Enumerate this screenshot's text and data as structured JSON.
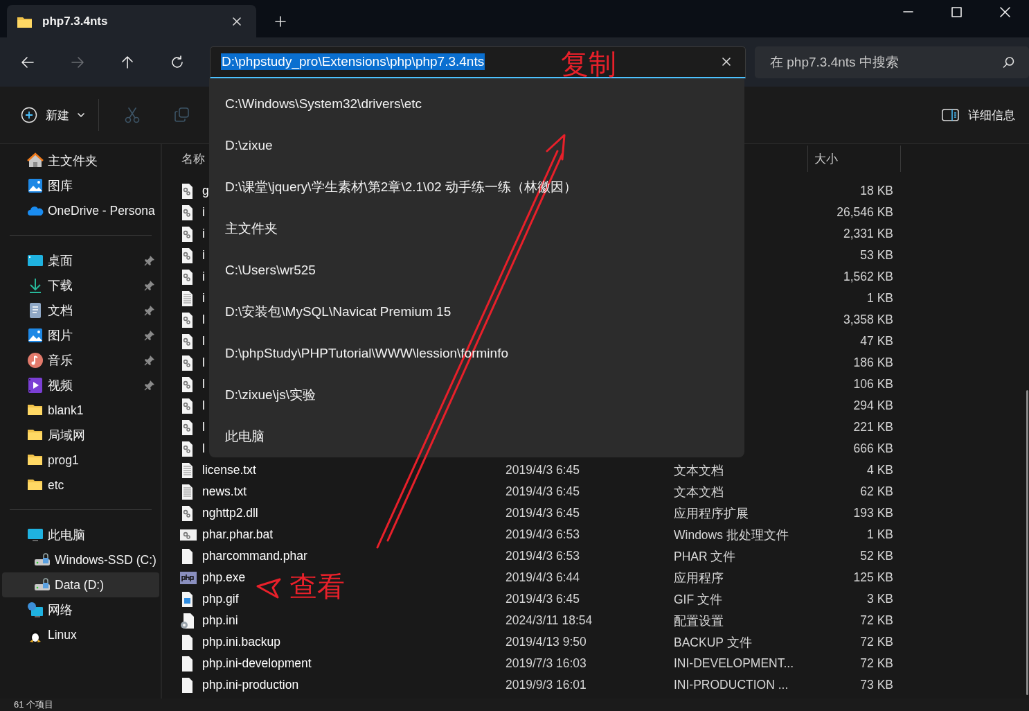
{
  "tabs": [
    {
      "title": "php7.3.4nts",
      "selected": true
    }
  ],
  "nav_buttons": [
    {
      "kind": "back",
      "disabled": false
    },
    {
      "kind": "forward",
      "disabled": true
    },
    {
      "kind": "up",
      "disabled": false
    },
    {
      "kind": "refresh",
      "disabled": false
    }
  ],
  "address_bar": {
    "value": "D:\\phpstudy_pro\\Extensions\\php\\php7.3.4nts",
    "selected": true
  },
  "address_history": [
    "C:\\Windows\\System32\\drivers\\etc",
    "D:\\zixue",
    "D:\\课堂\\jquery\\学生素材\\第2章\\2.1\\02 动手练一练（林徽因）",
    "主文件夹",
    "C:\\Users\\wr525",
    "D:\\安装包\\MySQL\\Navicat Premium 15",
    "D:\\phpStudy\\PHPTutorial\\WWW\\lession\\forminfo",
    "D:\\zixue\\js\\实验",
    "此电脑"
  ],
  "search": {
    "placeholder": "在 php7.3.4nts 中搜索"
  },
  "toolbar": {
    "new_button": {
      "label": "新建"
    },
    "actions": [
      {
        "kind": "cut",
        "disabled": true
      },
      {
        "kind": "copy",
        "disabled": true
      }
    ],
    "details_button": {
      "label": "详细信息"
    }
  },
  "sidebar": {
    "groups": [
      [
        {
          "label": "主文件夹",
          "kind": "home",
          "pinned": false,
          "selected": false
        },
        {
          "label": "图库",
          "kind": "gallery",
          "pinned": false,
          "selected": false
        },
        {
          "label": "OneDrive - Persona",
          "kind": "cloud",
          "pinned": false,
          "selected": false
        }
      ],
      [
        {
          "label": "桌面",
          "kind": "desktop",
          "pinned": true,
          "selected": false
        },
        {
          "label": "下载",
          "kind": "download",
          "pinned": true,
          "selected": false
        },
        {
          "label": "文档",
          "kind": "document",
          "pinned": true,
          "selected": false
        },
        {
          "label": "图片",
          "kind": "pictures",
          "pinned": true,
          "selected": false
        },
        {
          "label": "音乐",
          "kind": "music",
          "pinned": true,
          "selected": false
        },
        {
          "label": "视频",
          "kind": "video",
          "pinned": true,
          "selected": false
        },
        {
          "label": "blank1",
          "kind": "folder",
          "pinned": false,
          "selected": false
        },
        {
          "label": "局域网",
          "kind": "folder",
          "pinned": false,
          "selected": false
        },
        {
          "label": "prog1",
          "kind": "folder",
          "pinned": false,
          "selected": false
        },
        {
          "label": "etc",
          "kind": "folder",
          "pinned": false,
          "selected": false
        }
      ],
      [
        {
          "label": "此电脑",
          "kind": "pc",
          "pinned": false,
          "selected": false,
          "children": [
            {
              "label": "Windows-SSD (C:)",
              "kind": "drive",
              "pinned": false,
              "selected": false
            },
            {
              "label": "Data (D:)",
              "kind": "drive",
              "pinned": false,
              "selected": true
            }
          ]
        },
        {
          "label": "网络",
          "kind": "network",
          "pinned": false,
          "selected": false
        },
        {
          "label": "Linux",
          "kind": "linux",
          "pinned": false,
          "selected": false
        }
      ]
    ]
  },
  "file_list": {
    "columns": [
      "名称",
      "大小"
    ],
    "rows": [
      {
        "kind": "dll",
        "name": "g",
        "size": "18 KB"
      },
      {
        "kind": "dll",
        "name": "i",
        "size": "26,546 KB"
      },
      {
        "kind": "dll",
        "name": "i",
        "size": "2,331 KB"
      },
      {
        "kind": "dll",
        "name": "i",
        "size": "53 KB"
      },
      {
        "kind": "dll",
        "name": "i",
        "size": "1,562 KB"
      },
      {
        "kind": "txt",
        "name": "i",
        "size": "1 KB"
      },
      {
        "kind": "dll",
        "name": "l",
        "size": "3,358 KB"
      },
      {
        "kind": "dll",
        "name": "l",
        "size": "47 KB"
      },
      {
        "kind": "dll",
        "name": "l",
        "size": "186 KB"
      },
      {
        "kind": "dll",
        "name": "l",
        "size": "106 KB"
      },
      {
        "kind": "dll",
        "name": "l",
        "size": "294 KB"
      },
      {
        "kind": "dll",
        "name": "l",
        "size": "221 KB"
      },
      {
        "kind": "dll",
        "name": "l",
        "size": "666 KB"
      },
      {
        "kind": "txt",
        "name": "license.txt",
        "date": "2019/4/3 6:45",
        "type": "文本文档",
        "size": "4 KB"
      },
      {
        "kind": "txt",
        "name": "news.txt",
        "date": "2019/4/3 6:45",
        "type": "文本文档",
        "size": "62 KB"
      },
      {
        "kind": "dll",
        "name": "nghttp2.dll",
        "date": "2019/4/3 6:45",
        "type": "应用程序扩展",
        "size": "193 KB"
      },
      {
        "kind": "bat",
        "name": "phar.phar.bat",
        "date": "2019/4/3 6:53",
        "type": "Windows 批处理文件",
        "size": "1 KB"
      },
      {
        "kind": "file",
        "name": "pharcommand.phar",
        "date": "2019/4/3 6:53",
        "type": "PHAR 文件",
        "size": "52 KB"
      },
      {
        "kind": "exe",
        "name": "php.exe",
        "date": "2019/4/3 6:44",
        "type": "应用程序",
        "size": "125 KB"
      },
      {
        "kind": "gif",
        "name": "php.gif",
        "date": "2019/4/3 6:45",
        "type": "GIF 文件",
        "size": "3 KB"
      },
      {
        "kind": "ini",
        "name": "php.ini",
        "date": "2024/3/11 18:54",
        "type": "配置设置",
        "size": "72 KB"
      },
      {
        "kind": "file",
        "name": "php.ini.backup",
        "date": "2019/4/13 9:50",
        "type": "BACKUP 文件",
        "size": "72 KB"
      },
      {
        "kind": "file",
        "name": "php.ini-development",
        "date": "2019/7/3 16:03",
        "type": "INI-DEVELOPMENT...",
        "size": "72 KB"
      },
      {
        "kind": "file",
        "name": "php.ini-production",
        "date": "2019/9/3 16:01",
        "type": "INI-PRODUCTION ...",
        "size": "73 KB"
      }
    ]
  },
  "status_bar": {
    "item_count": "61 个项目"
  },
  "annotations": [
    {
      "kind": "label",
      "text": "复制"
    },
    {
      "kind": "arrow"
    },
    {
      "kind": "pointer"
    },
    {
      "kind": "label",
      "text": "查看"
    }
  ]
}
